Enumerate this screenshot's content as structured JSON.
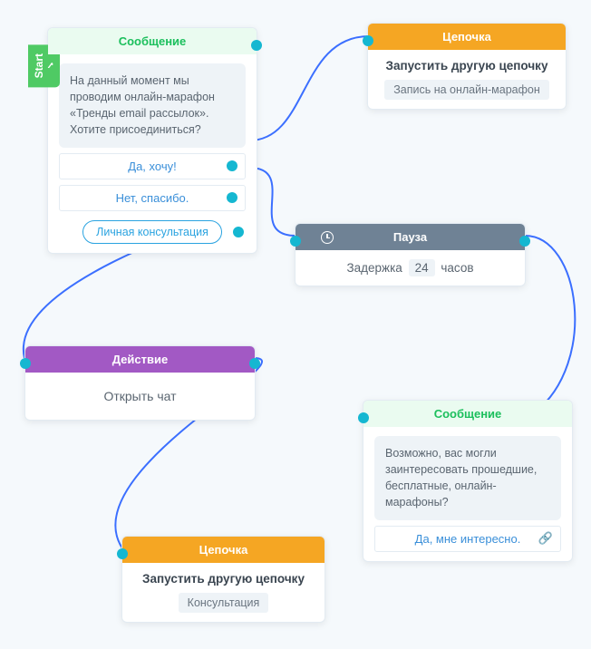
{
  "start_label": "Start",
  "node1": {
    "header": "Сообщение",
    "bubble": "На данный момент мы проводим онлайн-марафон «Тренды email рассылок». Хотите присоединиться?",
    "opt1": "Да, хочу!",
    "opt2": "Нет, спасибо.",
    "pill": "Личная консультация"
  },
  "node2": {
    "header": "Цепочка",
    "title": "Запустить другую цепочку",
    "badge": "Запись на онлайн-марафон"
  },
  "node3": {
    "header": "Пауза",
    "prefix": "Задержка",
    "value": "24",
    "suffix": "часов"
  },
  "node4": {
    "header": "Действие",
    "body": "Открыть чат"
  },
  "node5": {
    "header": "Сообщение",
    "bubble": "Возможно, вас могли заинтересовать прошедшие, бесплатные, онлайн-марафоны?",
    "opt1": "Да, мне интересно."
  },
  "node6": {
    "header": "Цепочка",
    "title": "Запустить другую цепочку",
    "badge": "Консультация"
  }
}
